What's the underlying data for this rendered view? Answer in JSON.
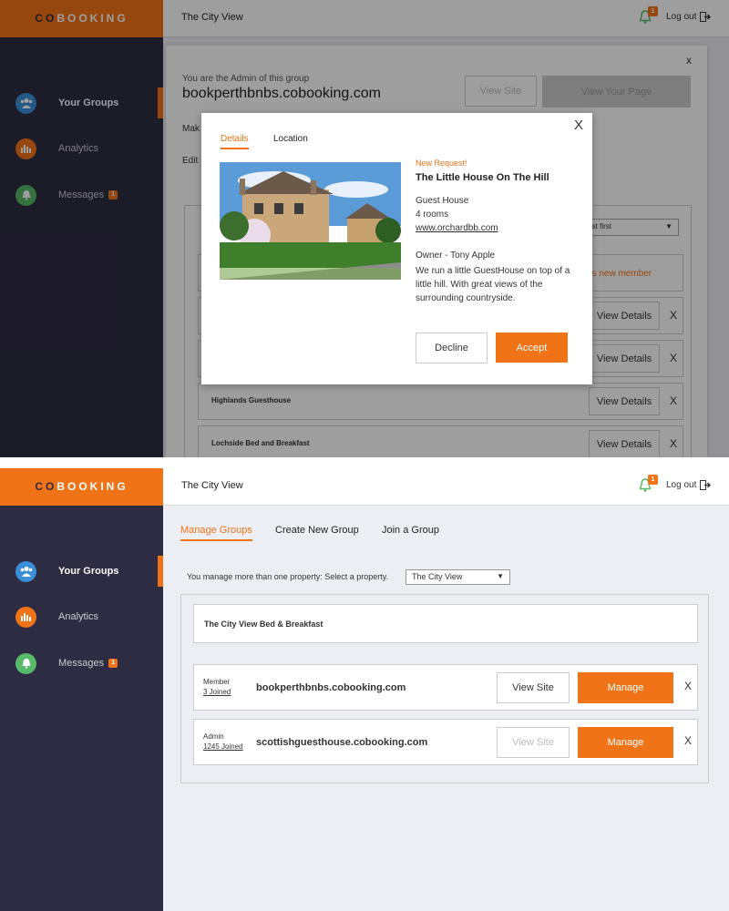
{
  "brand": {
    "prefix": "CO",
    "suffix": "BOOKING",
    "color": "#f07317"
  },
  "topbar": {
    "title": "The City View",
    "notif_count": "1",
    "logout_label": "Log out"
  },
  "sidebar": {
    "items": [
      {
        "label": "Your Groups",
        "icon": "users-icon",
        "active": true
      },
      {
        "label": "Analytics",
        "icon": "bar-chart-icon",
        "active": false
      },
      {
        "label": "Messages",
        "icon": "bell-icon",
        "badge": "1",
        "active": false
      }
    ]
  },
  "screen1": {
    "admin_note": "You are the Admin of this group",
    "domain": "bookperthbnbs.cobooking.com",
    "view_site_label": "View Site",
    "view_page_label": "View Your Page",
    "close_label": "x",
    "make_prefix": "Mak",
    "edit_prefix": "Edit",
    "sort_value": "ewest first",
    "new_member_snippet": "this new member",
    "rows": [
      {
        "name": "",
        "action": "View Details",
        "remove": "X"
      },
      {
        "name": "",
        "action": "View Details",
        "remove": "X"
      },
      {
        "name": "Highlands Guesthouse",
        "action": "View Details",
        "remove": "X"
      },
      {
        "name": "Lochside Bed and Breakfast",
        "action": "View Details",
        "remove": "X"
      }
    ],
    "modal": {
      "tabs": [
        "Details",
        "Location"
      ],
      "close": "X",
      "request_label": "New Request!",
      "property_name": "The Little House On The Hill",
      "type": "Guest House",
      "rooms": "4 rooms",
      "website": "www.orchardbb.com",
      "owner": "Owner - Tony Apple",
      "description": "We run a little GuestHouse on top of a little hill. With great views of the surrounding countryside.",
      "decline_label": "Decline",
      "accept_label": "Accept"
    }
  },
  "screen2": {
    "tabs": [
      "Manage Groups",
      "Create New Group",
      "Join a Group"
    ],
    "select_prompt": "You manage more than one property: Select a property.",
    "selected_property": "The City View",
    "property_title": "The City View Bed & Breakfast",
    "groups": [
      {
        "role": "Member",
        "joined": "3 Joined",
        "domain": "bookperthbnbs.cobooking.com",
        "view_site": "View Site",
        "manage": "Manage",
        "remove": "X",
        "view_site_disabled": false
      },
      {
        "role": "Admin",
        "joined": "1245 Joined",
        "domain": "scottishguesthouse.cobooking.com",
        "view_site": "View Site",
        "manage": "Manage",
        "remove": "X",
        "view_site_disabled": true
      }
    ]
  }
}
